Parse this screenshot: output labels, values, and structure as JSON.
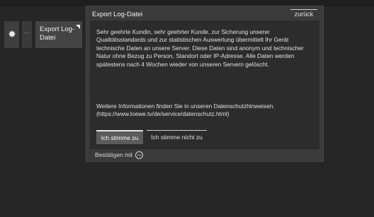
{
  "menu": {
    "gear_icon": "gear-icon",
    "dots": "...",
    "export_item": "Export Log-Datei"
  },
  "dialog": {
    "title": "Export Log-Datei",
    "back_label": "zurück",
    "para1": "Sehr geehrte Kundin, sehr geehrter Kunde, zur Sicherung unserer Qualitätsstandards und zur statistischen Auswertung übermittelt Ihr Gerät technische Daten an unsere Server. Diese Daten sind anonym und technischer Natur ohne Bezug zu Person, Standort oder IP-Adresse. Alle Daten werden spätestens nach 4 Wochen wieder von unseren Servern gelöscht.",
    "para2": "Weitere Informationen finden Sie in unseren Datenschutzhinweisen. (https://www.loewe.tv/de/service/datenschutz.html)",
    "agree_label": "Ich stimme zu",
    "disagree_label": "Ich stimme nicht zu",
    "footer_label": "Bestätigen mit",
    "footer_icon": "OK"
  }
}
